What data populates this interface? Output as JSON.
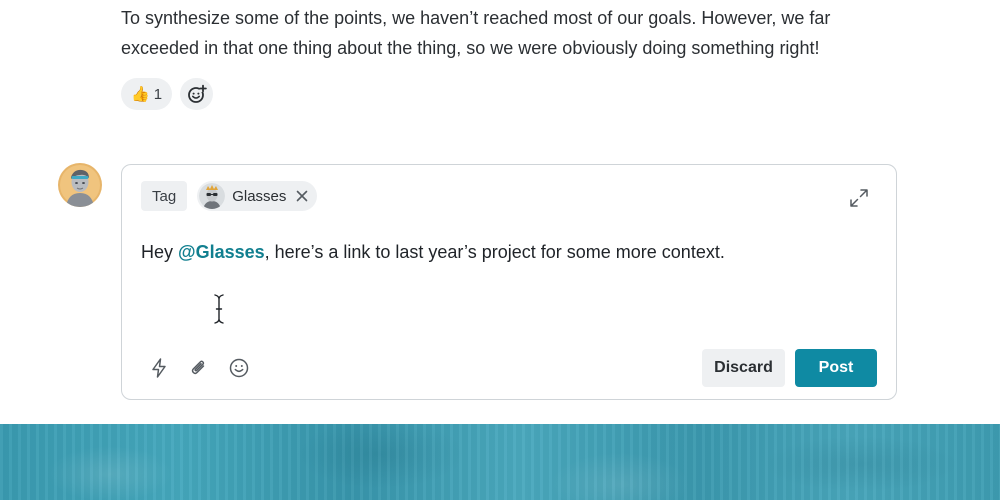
{
  "previous_comment": {
    "text": "To synthesize some of the points, we haven’t reached most of our goals. However, we far exceeded in that one thing about the thing, so we were obviously doing something right!",
    "reactions": [
      {
        "emoji": "👍",
        "count": "1"
      }
    ],
    "add_reaction_icon": "add-emoji-icon"
  },
  "composer": {
    "tag_label": "Tag",
    "tagged_user": {
      "name": "Glasses",
      "remove_icon": "close-icon"
    },
    "expand_icon": "expand-icon",
    "message": {
      "before": "Hey ",
      "mention": "@Glasses",
      "after": ", here’s a link to last year’s project for some more context."
    },
    "tools": [
      "lightning-icon",
      "paperclip-icon",
      "smiley-icon"
    ],
    "discard_label": "Discard",
    "post_label": "Post"
  },
  "colors": {
    "accent": "#0f8aa3",
    "mention": "#117f8f",
    "chip_bg": "#eef0f2",
    "border": "#cfd4d8"
  }
}
